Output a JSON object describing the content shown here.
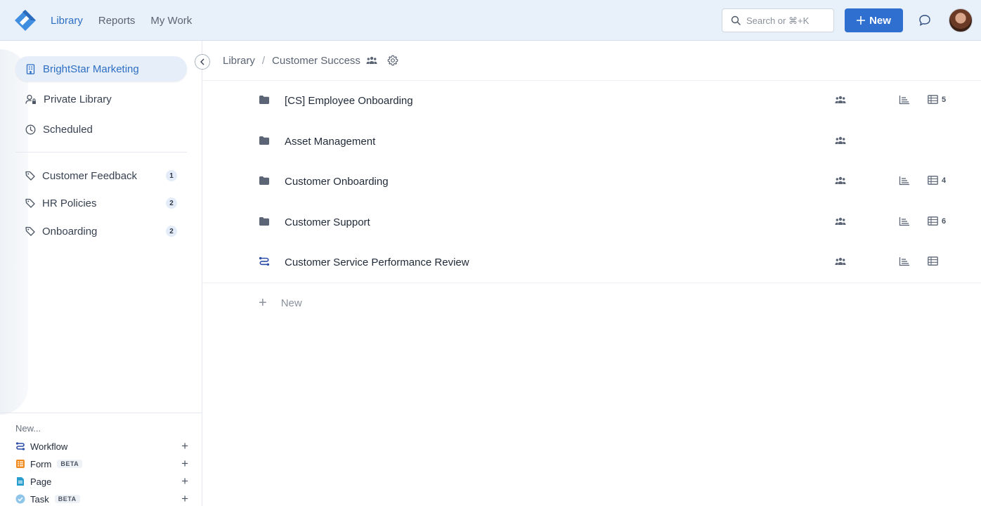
{
  "topbar": {
    "nav": [
      "Library",
      "Reports",
      "My Work"
    ],
    "search_placeholder": "Search or ⌘+K",
    "new_label": "New"
  },
  "sidebar": {
    "items": [
      {
        "label": "BrightStar Marketing",
        "icon": "building-icon",
        "active": true
      },
      {
        "label": "Private Library",
        "icon": "user-lock-icon"
      },
      {
        "label": "Scheduled",
        "icon": "clock-icon"
      }
    ],
    "tags": [
      {
        "label": "Customer Feedback",
        "count": "1"
      },
      {
        "label": "HR Policies",
        "count": "2"
      },
      {
        "label": "Onboarding",
        "count": "2"
      }
    ],
    "new_label": "New...",
    "create": [
      {
        "label": "Workflow",
        "icon": "workflow-icon",
        "beta": ""
      },
      {
        "label": "Form",
        "icon": "form-icon",
        "beta": "BETA"
      },
      {
        "label": "Page",
        "icon": "page-icon",
        "beta": ""
      },
      {
        "label": "Task",
        "icon": "task-icon",
        "beta": "BETA"
      }
    ]
  },
  "breadcrumb": {
    "root": "Library",
    "separator": "/",
    "current": "Customer Success"
  },
  "rows": [
    {
      "name": "[CS] Employee Onboarding",
      "type": "folder",
      "chart": true,
      "table_count": "5"
    },
    {
      "name": "Asset Management",
      "type": "folder",
      "chart": false,
      "table_count": null
    },
    {
      "name": "Customer Onboarding",
      "type": "folder",
      "chart": true,
      "table_count": "4"
    },
    {
      "name": "Customer Support",
      "type": "folder",
      "chart": true,
      "table_count": "6"
    },
    {
      "name": "Customer Service Performance Review",
      "type": "workflow",
      "chart": true,
      "table_count": ""
    }
  ],
  "add_new_label": "New",
  "colors": {
    "accent": "#2e6fd0",
    "topbar": "#e8f0fa",
    "icon": "#5b6576"
  }
}
